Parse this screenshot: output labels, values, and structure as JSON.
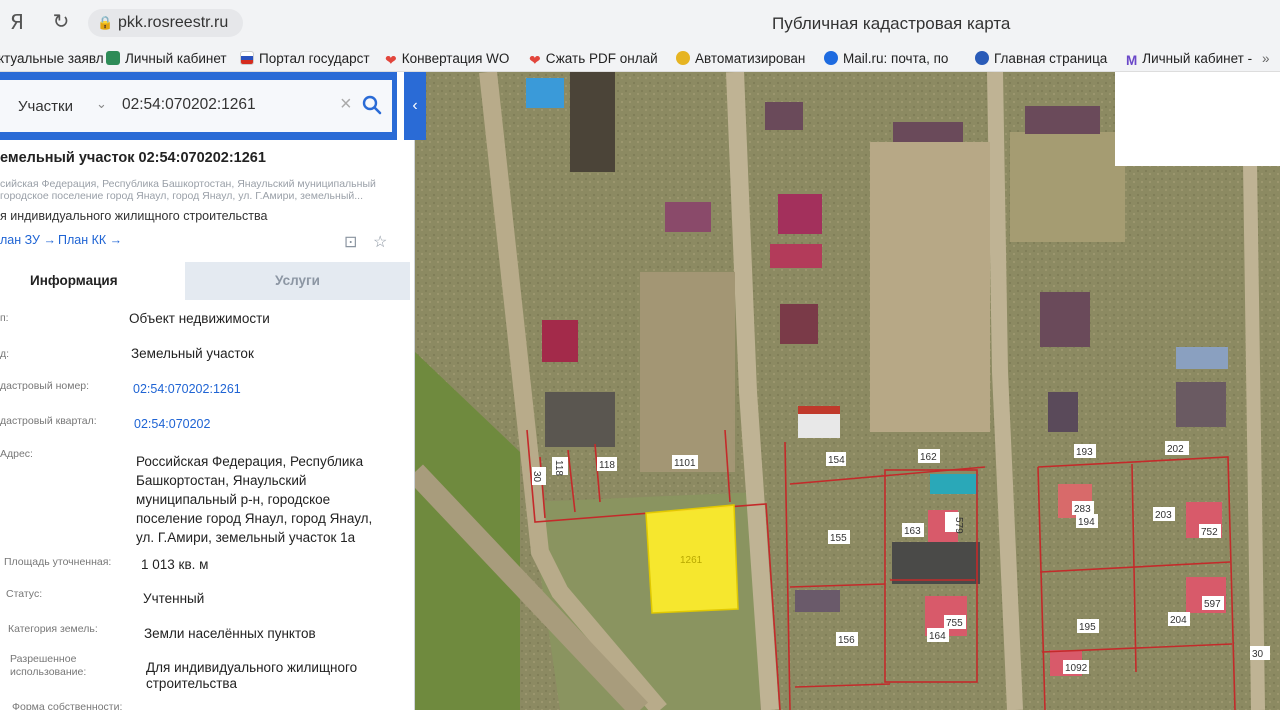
{
  "browser": {
    "url": "pkk.rosreestr.ru",
    "page_title": "Публичная кадастровая карта",
    "bookmarks": [
      {
        "label": "ктуальные заявл",
        "icon": "doc-icon",
        "color": "#e8e8e8"
      },
      {
        "label": "Личный кабинет",
        "icon": "gosuslugi-icon",
        "color": "#2e8b57"
      },
      {
        "label": "Портал государст",
        "icon": "flag-icon",
        "color": "#d83b3b"
      },
      {
        "label": "Конвертация WO",
        "icon": "heart-icon",
        "color": "#e2453c"
      },
      {
        "label": "Сжать PDF онлай",
        "icon": "heart-icon",
        "color": "#e2453c"
      },
      {
        "label": "Автоматизирован",
        "icon": "emblem-icon",
        "color": "#e6b422"
      },
      {
        "label": "Mail.ru: почта, по",
        "icon": "mail-icon",
        "color": "#1e6be0"
      },
      {
        "label": "Главная страница",
        "icon": "globe-icon",
        "color": "#2a5bb8"
      },
      {
        "label": "Личный кабинет -",
        "icon": "m-icon",
        "color": "#6a47c8"
      }
    ]
  },
  "search": {
    "type": "Участки",
    "query": "02:54:070202:1261"
  },
  "object": {
    "title": "емельный участок 02:54:070202:1261",
    "address_line1": "сийская Федерация, Республика Башкортостан, Янаульский муниципальный",
    "address_line2": "городское поселение город Янаул, город Янаул, ул. Г.Амири, земельный...",
    "purpose": "я индивидуального жилищного строительства",
    "link_zu": "лан ЗУ →",
    "link_kk": "План КК →"
  },
  "tabs": {
    "info": "Информация",
    "services": "Услуги"
  },
  "rows": [
    {
      "label": "п:",
      "value": "Объект недвижимости"
    },
    {
      "label": "д:",
      "value": "Земельный участок"
    },
    {
      "label": "дастровый номер:",
      "value": "02:54:070202:1261"
    },
    {
      "label": "дастровый квартал:",
      "value": "02:54:070202"
    },
    {
      "label": "Адрес:",
      "value_lines": [
        "Российская Федерация, Республика",
        "Башкортостан, Янаульский",
        "муниципальный р-н, городское",
        "поселение город Янаул, город Янаул,",
        "ул. Г.Амири, земельный участок 1а"
      ]
    },
    {
      "label": "Площадь уточненная:",
      "value": "1 013 кв. м"
    },
    {
      "label": "Статус:",
      "value": "Учтенный"
    },
    {
      "label": "Категория земель:",
      "value": "Земли населённых пунктов"
    },
    {
      "label_lines": [
        "Разрешенное",
        "использование:"
      ],
      "value_lines": [
        "Для индивидуального жилищного",
        "строительства"
      ]
    },
    {
      "label": "Форма собственности:"
    }
  ],
  "map_labels": {
    "selected_parcel": "1261",
    "parcels": [
      "30",
      "118",
      "118",
      "1101",
      "154",
      "162",
      "155",
      "163",
      "579",
      "156",
      "164",
      "755",
      "193",
      "202",
      "283",
      "194",
      "203",
      "752",
      "195",
      "204",
      "597",
      "1092",
      "30"
    ]
  },
  "colors": {
    "accent": "#2a6bd6",
    "selected_parcel_fill": "#ffee2a",
    "parcel_border": "#c42a2a",
    "link": "#1f64d4"
  }
}
